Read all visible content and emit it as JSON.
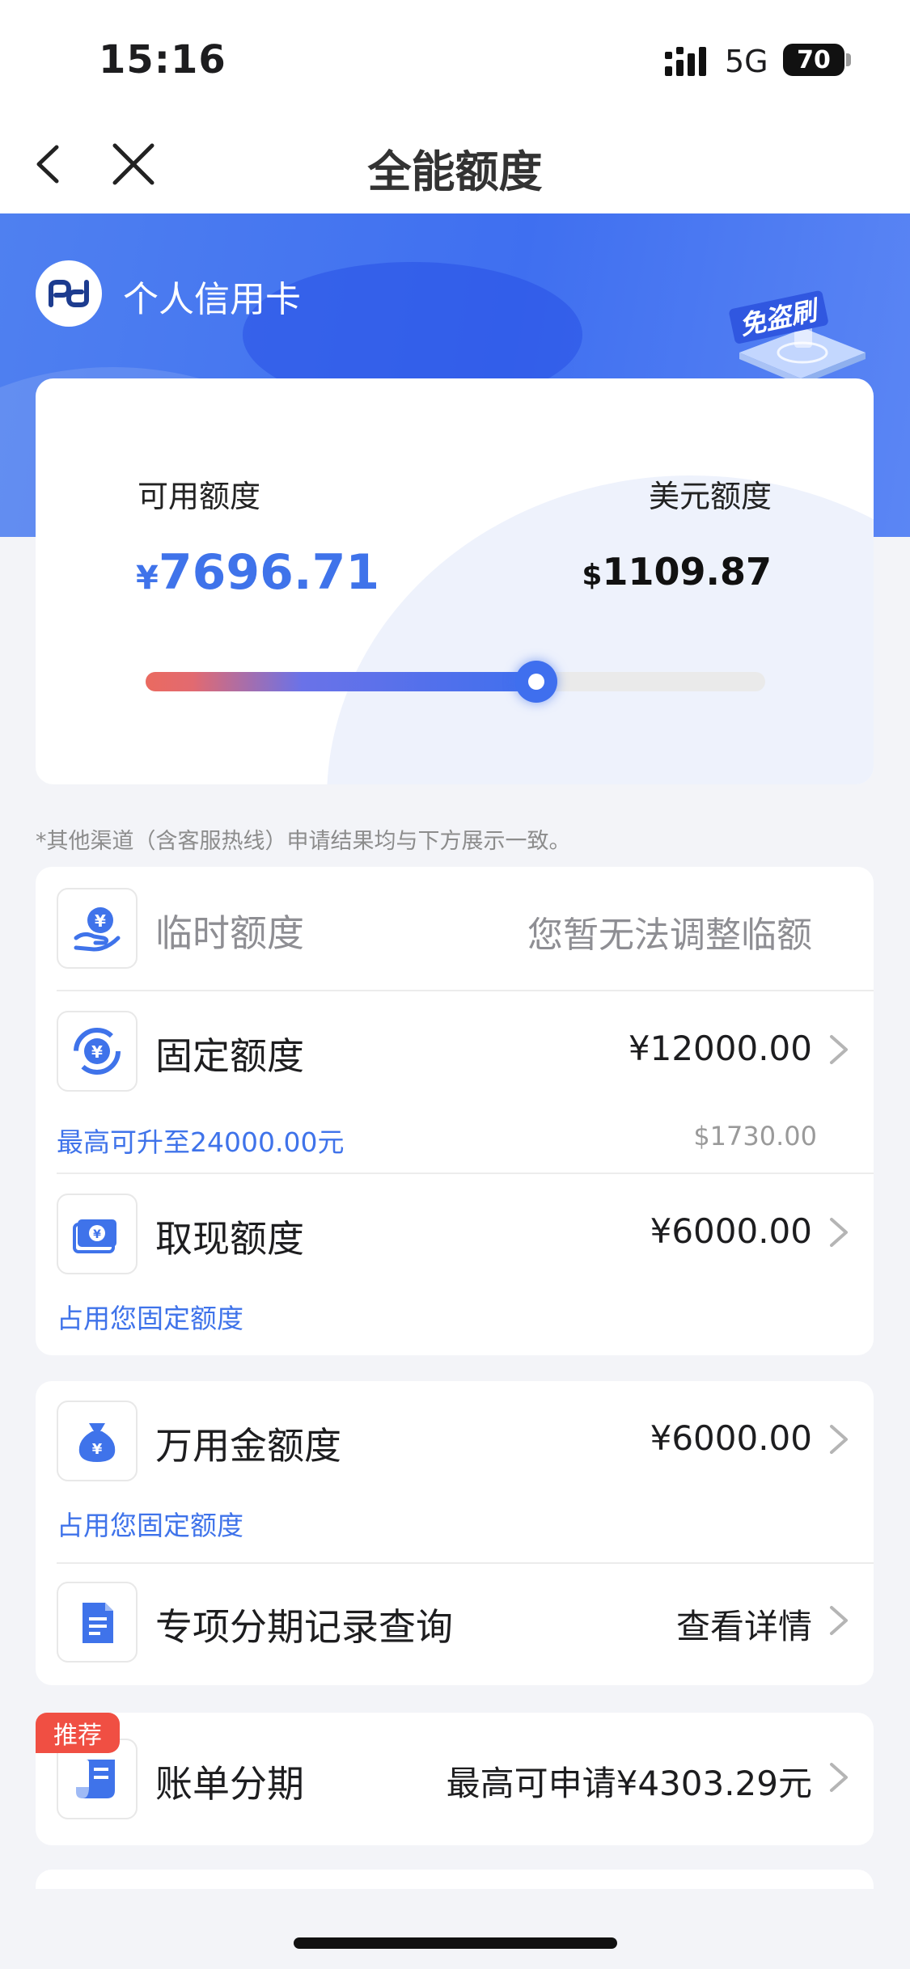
{
  "status": {
    "time": "15:16",
    "network": "5G",
    "battery": "70"
  },
  "nav": {
    "title": "全能额度"
  },
  "hero": {
    "title": "个人信用卡",
    "badge": "免盗刷"
  },
  "limits": {
    "available_label": "可用额度",
    "available_currency": "¥",
    "available_amount": "7696.71",
    "usd_label": "美元额度",
    "usd_currency": "$",
    "usd_amount": "1109.87",
    "used_fraction": 0.63
  },
  "note": "*其他渠道（含客服热线）申请结果均与下方展示一致。",
  "card1": {
    "temp": {
      "title": "临时额度",
      "value": "您暂无法调整临额"
    },
    "fixed": {
      "title": "固定额度",
      "value": "¥12000.00",
      "sub": "最高可升至24000.00元",
      "sub_right": "$1730.00"
    },
    "cash": {
      "title": "取现额度",
      "value": "¥6000.00",
      "sub": "占用您固定额度"
    }
  },
  "card2": {
    "wanyong": {
      "title": "万用金额度",
      "value": "¥6000.00",
      "sub": "占用您固定额度"
    },
    "installment_query": {
      "title": "专项分期记录查询",
      "value": "查看详情"
    }
  },
  "card3": {
    "tag": "推荐",
    "bill_installment": {
      "title": "账单分期",
      "value": "最高可申请¥4303.29元"
    }
  },
  "colors": {
    "accent": "#3f73ea",
    "tag": "#f04f43"
  }
}
